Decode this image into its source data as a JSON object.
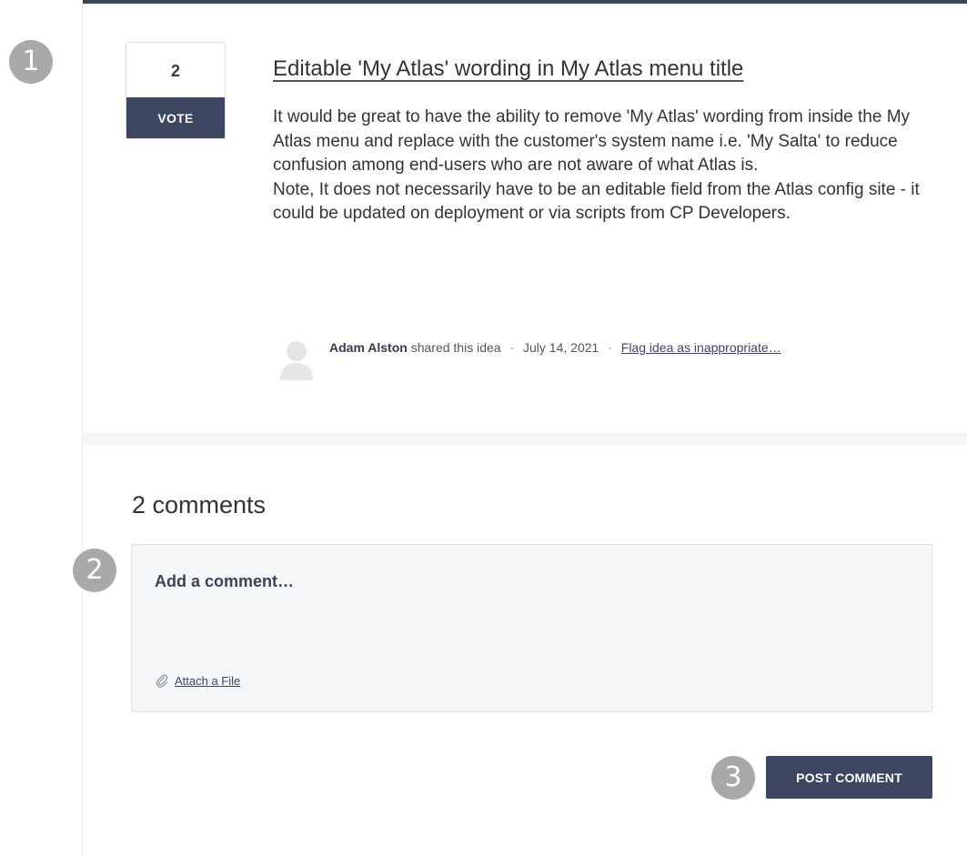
{
  "callouts": [
    "1",
    "2",
    "3"
  ],
  "idea": {
    "vote_count": "2",
    "vote_label": "VOTE",
    "title": "Editable 'My Atlas' wording in My Atlas menu title",
    "body": [
      "It would be great to have the ability to remove 'My Atlas' wording from inside the My Atlas menu and replace with the customer's system name i.e. 'My Salta' to reduce confusion among end-users who are not aware of what Atlas is.",
      "Note, It does not necessarily have to be an editable field from the Atlas config site - it could be updated on deployment or via scripts from CP Developers."
    ],
    "author": "Adam Alston",
    "shared_text": "shared this idea",
    "separator": "·",
    "date": "July 14, 2021",
    "flag_link": "Flag idea as inappropriate…"
  },
  "comments": {
    "heading": "2 comments",
    "input_placeholder": "Add a comment…",
    "attach_label": "Attach a File",
    "post_label": "POST COMMENT"
  },
  "icons": {
    "avatar": "user-silhouette-icon",
    "attach": "paperclip-icon"
  },
  "colors": {
    "primary": "#3c4660",
    "callout": "#a9a9a9",
    "panel_bg": "#f5f6f7"
  }
}
